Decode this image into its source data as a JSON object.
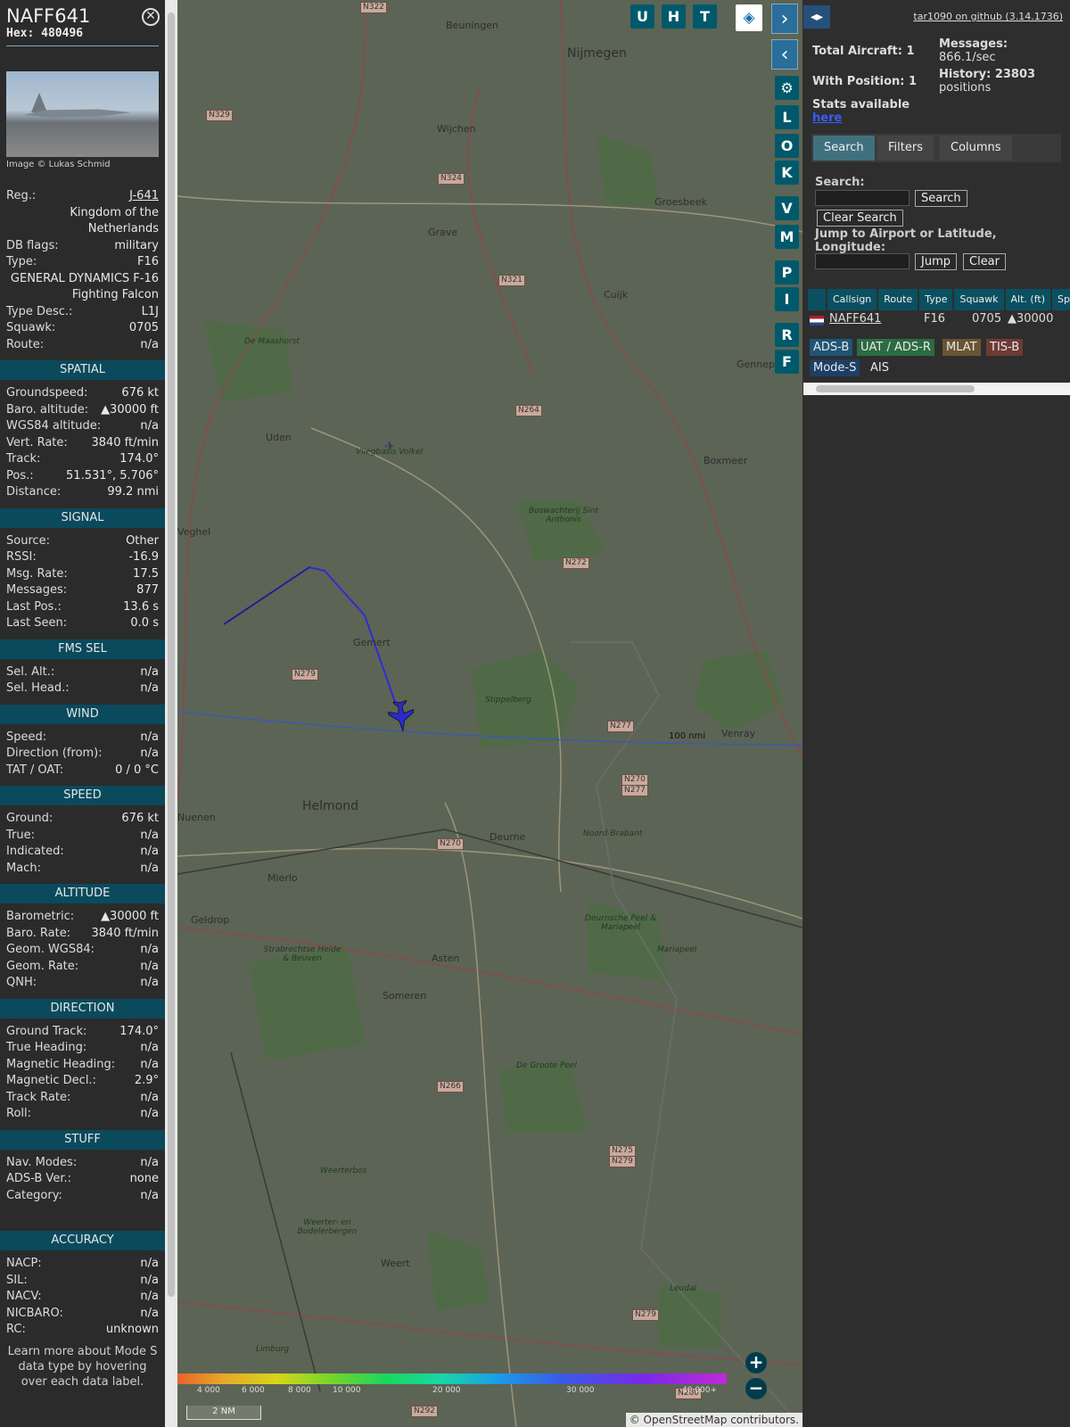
{
  "aircraft": {
    "callsign": "NAFF641",
    "hex": "Hex: 480496",
    "photo_credit": "Image © Lukas Schmid",
    "details": [
      {
        "label": "Reg.:",
        "value": "J-641"
      },
      {
        "label": "",
        "value": "Kingdom of the Netherlands"
      },
      {
        "label": "DB flags:",
        "value": "military"
      },
      {
        "label": "Type:",
        "value": "F16"
      },
      {
        "label": "",
        "value": "GENERAL DYNAMICS F-16 Fighting Falcon"
      },
      {
        "label": "Type Desc.:",
        "value": "L1J"
      },
      {
        "label": "Squawk:",
        "value": "0705"
      },
      {
        "label": "Route:",
        "value": "n/a"
      }
    ],
    "sections": [
      {
        "title": "SPATIAL",
        "rows": [
          {
            "label": "Groundspeed:",
            "value": "676 kt"
          },
          {
            "label": "Baro. altitude:",
            "value": "▲30000 ft"
          },
          {
            "label": "WGS84 altitude:",
            "value": "n/a"
          },
          {
            "label": "Vert. Rate:",
            "value": "3840 ft/min"
          },
          {
            "label": "Track:",
            "value": "174.0°"
          },
          {
            "label": "Pos.:",
            "value": "51.531°, 5.706°"
          },
          {
            "label": "Distance:",
            "value": "99.2 nmi"
          }
        ]
      },
      {
        "title": "SIGNAL",
        "rows": [
          {
            "label": "Source:",
            "value": "Other"
          },
          {
            "label": "RSSI:",
            "value": "-16.9"
          },
          {
            "label": "Msg. Rate:",
            "value": "17.5"
          },
          {
            "label": "Messages:",
            "value": "877"
          },
          {
            "label": "Last Pos.:",
            "value": "13.6 s"
          },
          {
            "label": "Last Seen:",
            "value": "0.0 s"
          }
        ]
      },
      {
        "title": "FMS SEL",
        "rows": [
          {
            "label": "Sel. Alt.:",
            "value": "n/a"
          },
          {
            "label": "Sel. Head.:",
            "value": "n/a"
          }
        ]
      },
      {
        "title": "WIND",
        "rows": [
          {
            "label": "Speed:",
            "value": "n/a"
          },
          {
            "label": "Direction (from):",
            "value": "n/a"
          },
          {
            "label": "TAT / OAT:",
            "value": "0 / 0 °C"
          }
        ]
      },
      {
        "title": "SPEED",
        "rows": [
          {
            "label": "Ground:",
            "value": "676 kt"
          },
          {
            "label": "True:",
            "value": "n/a"
          },
          {
            "label": "Indicated:",
            "value": "n/a"
          },
          {
            "label": "Mach:",
            "value": "n/a"
          }
        ]
      },
      {
        "title": "ALTITUDE",
        "rows": [
          {
            "label": "Barometric:",
            "value": "▲30000 ft"
          },
          {
            "label": "Baro. Rate:",
            "value": "3840 ft/min"
          },
          {
            "label": "Geom. WGS84:",
            "value": "n/a"
          },
          {
            "label": "Geom. Rate:",
            "value": "n/a"
          },
          {
            "label": "QNH:",
            "value": "n/a"
          }
        ]
      },
      {
        "title": "DIRECTION",
        "rows": [
          {
            "label": "Ground Track:",
            "value": "174.0°"
          },
          {
            "label": "True Heading:",
            "value": "n/a"
          },
          {
            "label": "Magnetic Heading:",
            "value": "n/a"
          },
          {
            "label": "Magnetic Decl.:",
            "value": "2.9°"
          },
          {
            "label": "Track Rate:",
            "value": "n/a"
          },
          {
            "label": "Roll:",
            "value": "n/a"
          }
        ]
      },
      {
        "title": "STUFF",
        "rows": [
          {
            "label": "Nav. Modes:",
            "value": "n/a"
          },
          {
            "label": "ADS-B Ver.:",
            "value": "none"
          },
          {
            "label": "Category:",
            "value": "n/a"
          }
        ]
      },
      {
        "title": "ACCURACY",
        "rows": [
          {
            "label": "NACP:",
            "value": "n/a"
          },
          {
            "label": "SIL:",
            "value": "n/a"
          },
          {
            "label": "NACV:",
            "value": "n/a"
          },
          {
            "label": "NICBARO:",
            "value": "n/a"
          },
          {
            "label": "RC:",
            "value": "unknown"
          }
        ]
      }
    ],
    "footer": "Learn more about Mode S data type by hovering over each data label."
  },
  "map": {
    "buttons_top": [
      "U",
      "H",
      "T"
    ],
    "buttons_side": [
      "L",
      "O",
      "K",
      "V",
      "M",
      "P",
      "I",
      "R",
      "F"
    ],
    "places": [
      {
        "name": "Nijmegen",
        "big": true
      },
      {
        "name": "Beuningen"
      },
      {
        "name": "Wijchen"
      },
      {
        "name": "Grave"
      },
      {
        "name": "Groesbeek"
      },
      {
        "name": "Cuijk"
      },
      {
        "name": "Gennep"
      },
      {
        "name": "Uden"
      },
      {
        "name": "Boxmeer"
      },
      {
        "name": "Veghel"
      },
      {
        "name": "Gemert"
      },
      {
        "name": "Venray"
      },
      {
        "name": "Helmond",
        "big": true
      },
      {
        "name": "Nuenen"
      },
      {
        "name": "Deurne"
      },
      {
        "name": "Mierlo"
      },
      {
        "name": "Geldrop"
      },
      {
        "name": "Asten"
      },
      {
        "name": "Someren"
      },
      {
        "name": "Weert"
      },
      {
        "name": "De Maashorst"
      },
      {
        "name": "Stippelberg"
      },
      {
        "name": "Vliegbasis Volkel"
      },
      {
        "name": "Boswachterij Sint Anthonis"
      },
      {
        "name": "Deurnsche Peel & Mariapeel"
      },
      {
        "name": "Strabrechtse Heide & Beuven"
      },
      {
        "name": "De Groote Peel"
      },
      {
        "name": "Weerterbos"
      },
      {
        "name": "Weerter- en Budelerbergen"
      },
      {
        "name": "Leudal"
      },
      {
        "name": "Limburg"
      },
      {
        "name": "Noord-Brabant"
      },
      {
        "name": "Mariapeel"
      }
    ],
    "road_shields": [
      "N322",
      "N329",
      "N324",
      "N321",
      "N264",
      "N272",
      "N279",
      "N277",
      "N270",
      "N277",
      "N270",
      "N266",
      "N275",
      "N279",
      "N279",
      "N280",
      "N292"
    ],
    "range_ring_label": "100 nmi",
    "alt_ticks": [
      "4 000",
      "6 000",
      "8 000",
      "10 000",
      "20 000",
      "30 000",
      "40 000+"
    ],
    "scale": "2 NM",
    "attribution": "© OpenStreetMap contributors."
  },
  "sidebar": {
    "github": "tar1090 on github (3.14.1736)",
    "total_aircraft": "Total Aircraft: 1",
    "with_position": "With Position: 1",
    "messages_label": "Messages:",
    "messages_rate": "866.1/sec",
    "history_label": "History: 23803",
    "history_unit": "positions",
    "stats_text": "Stats available",
    "stats_link": "here",
    "tabs": [
      "Search",
      "Filters",
      "Columns"
    ],
    "search_label": "Search:",
    "search_btn": "Search",
    "clear_search_btn": "Clear Search",
    "jump_label": "Jump to Airport or Latitude, Longitude:",
    "jump_btn": "Jump",
    "clear_btn": "Clear",
    "columns": [
      "",
      "Callsign",
      "Route",
      "Type",
      "Squawk",
      "Alt. (ft)",
      "Sp"
    ],
    "row": {
      "callsign": "NAFF641",
      "type": "F16",
      "squawk": "0705",
      "alt": "▲30000"
    },
    "sources": [
      {
        "label": "ADS-B",
        "color": "#1f5577"
      },
      {
        "label": "UAT / ADS-R",
        "color": "#2c6b42"
      },
      {
        "label": "MLAT",
        "color": "#6a5433"
      },
      {
        "label": "TIS-B",
        "color": "#6e3a35"
      },
      {
        "label": "Mode-S",
        "color": "#1e3f66"
      },
      {
        "label": "AIS",
        "color": "#2e2e2e"
      }
    ]
  }
}
